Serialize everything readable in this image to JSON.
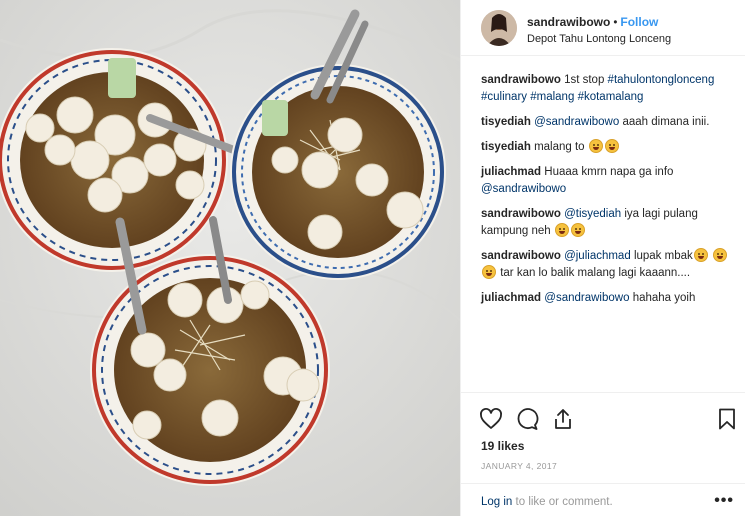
{
  "post": {
    "username": "sandrawibowo",
    "separator": "•",
    "follow_label": "Follow",
    "location": "Depot Tahu Lontong Lonceng"
  },
  "comments": [
    {
      "user": "sandrawibowo",
      "text_before": "1st stop ",
      "tags": [
        "#tahulontonglonceng",
        "#culinary",
        "#malang",
        "#kotamalang"
      ]
    },
    {
      "user": "tisyediah",
      "mention": "@sandrawibowo",
      "text": "aaah dimana inii."
    },
    {
      "user": "tisyediah",
      "text": "malang to"
    },
    {
      "user": "juliachmad",
      "text": "Huaaa kmrn napa ga info",
      "mention": "@sandrawibowo"
    },
    {
      "user": "sandrawibowo",
      "mention": "@tisyediah",
      "text": "iya lagi pulang kampung neh"
    },
    {
      "user": "sandrawibowo",
      "mention": "@juliachmad",
      "text": "lupak mbak",
      "text_after": "tar kan lo balik malang lagi kaaann...."
    },
    {
      "user": "juliachmad",
      "mention": "@sandrawibowo",
      "text": "hahaha yoih"
    }
  ],
  "actions": {
    "likes": "19 likes",
    "date": "JANUARY 4, 2017",
    "login_link": "Log in",
    "login_rest": " to like or comment.",
    "more": "•••",
    "icons": [
      "heart-icon",
      "comment-icon",
      "share-icon",
      "bookmark-icon"
    ]
  },
  "colors": {
    "link_blue": "#3897f0",
    "tag_blue": "#003569",
    "muted": "#999999",
    "text": "#262626"
  }
}
